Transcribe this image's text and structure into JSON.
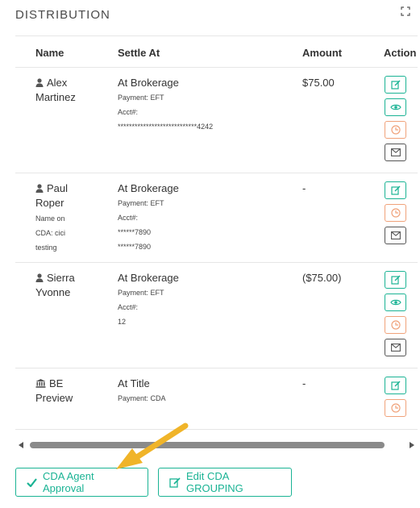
{
  "header": {
    "title": "DISTRIBUTION"
  },
  "table": {
    "columns": {
      "name": "Name",
      "settle": "Settle At",
      "amount": "Amount",
      "action": "Action"
    },
    "rows": [
      {
        "name_line1": "Alex",
        "name_line2": "Martinez",
        "name_note_1": "",
        "name_note_2": "",
        "settle_main": "At Brokerage",
        "settle_lines": [
          "Payment: EFT",
          "Acct#:",
          "****************************4242",
          ""
        ],
        "amount": "$75.00"
      },
      {
        "name_line1": "Paul",
        "name_line2": "Roper",
        "name_note_1": "Name on",
        "name_note_2": "CDA: cici",
        "name_note_3": "testing",
        "settle_main": "At Brokerage",
        "settle_lines": [
          "Payment: EFT",
          "Acct#:",
          "******7890",
          "******7890"
        ],
        "amount": "-"
      },
      {
        "name_line1": "Sierra",
        "name_line2": "Yvonne",
        "settle_main": "At Brokerage",
        "settle_lines": [
          "Payment: EFT",
          "Acct#:",
          "12",
          ""
        ],
        "amount": "($75.00)"
      },
      {
        "name_line1": "BE",
        "name_line2": "Preview",
        "settle_main": "At Title",
        "settle_lines": [
          "Payment: CDA",
          "",
          "",
          ""
        ],
        "amount": "-"
      }
    ]
  },
  "footer": {
    "approve_label": "CDA Agent Approval",
    "edit_label": "Edit CDA GROUPING"
  },
  "colors": {
    "accent": "#1ab394",
    "orange": "#f0a27a",
    "annotation_arrow": "#f0b429"
  }
}
